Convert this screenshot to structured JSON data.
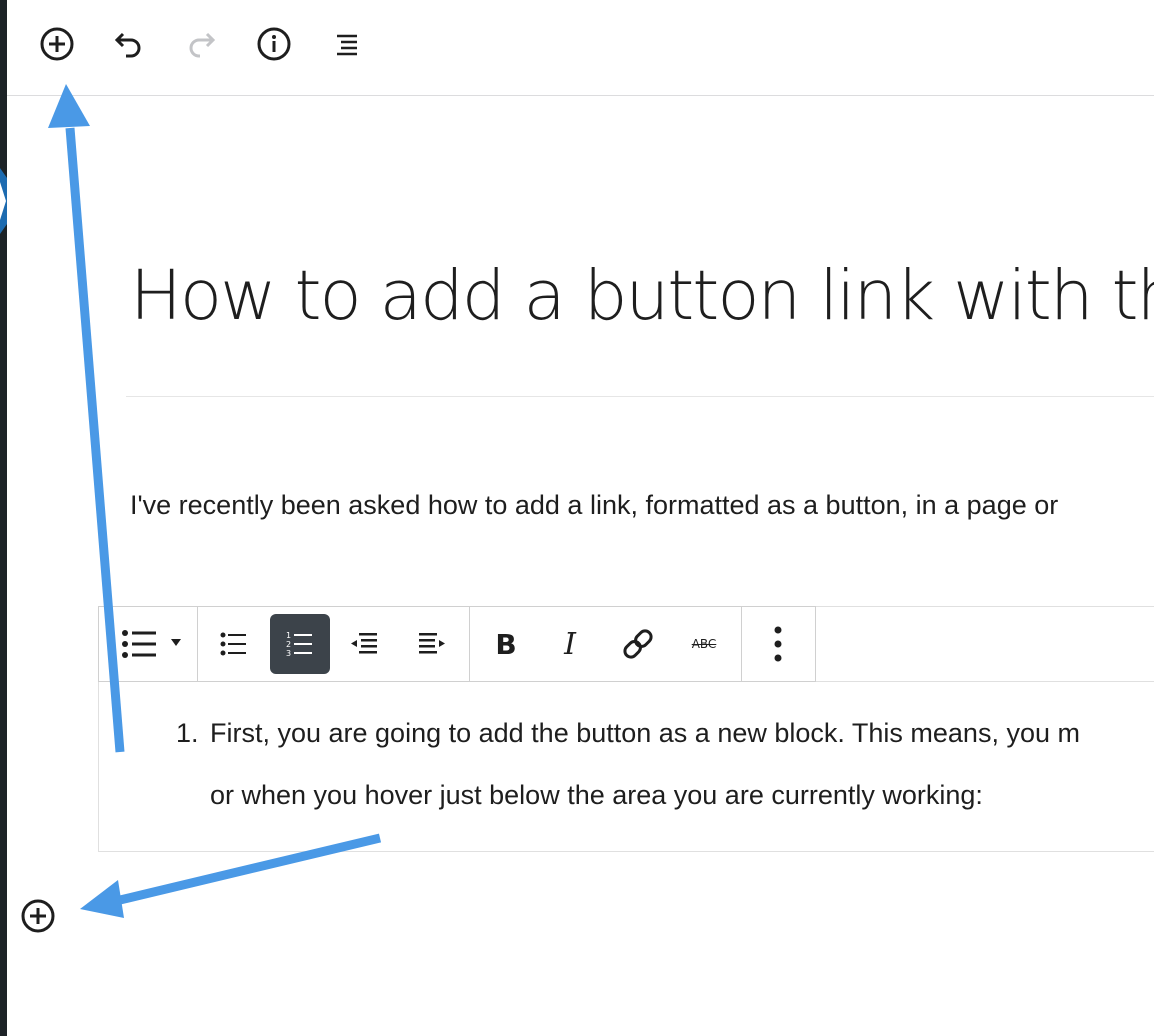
{
  "toolbar": {
    "icons": [
      "add-block-icon",
      "undo-icon",
      "redo-icon",
      "info-icon",
      "list-view-icon"
    ],
    "colors": {
      "enabled": "#1e1e1e",
      "disabled": "#c3c4c7"
    }
  },
  "post": {
    "title": "How to add a button link with th",
    "paragraph": "I've recently been asked how to add a link, formatted as a button, in a page or"
  },
  "block_toolbar": {
    "icons": [
      "list-type-icon",
      "unordered-list-icon",
      "ordered-list-icon",
      "outdent-icon",
      "indent-icon",
      "bold-icon",
      "italic-icon",
      "link-icon",
      "strikethrough-icon",
      "more-options-icon"
    ],
    "bold_label": "B",
    "italic_label": "I",
    "strike_label": "ABC",
    "active_color": "#3c434a"
  },
  "list": {
    "number": "1.",
    "line1": "First, you are going to add the button as a new block. This means, you m",
    "line2": "or when you hover just below the area you are currently working:"
  },
  "annotation": {
    "arrow_color": "#4a99e6"
  }
}
